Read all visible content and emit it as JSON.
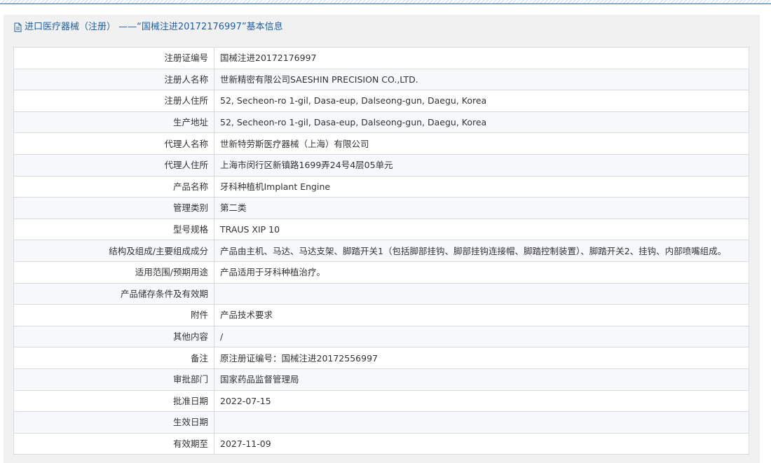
{
  "header": {
    "icon": "document-icon",
    "title": "进口医疗器械（注册） ——“国械注进20172176997”基本信息",
    "title_color": "#1f5fa8"
  },
  "rows": [
    {
      "label": "注册证编号",
      "value": "国械注进20172176997"
    },
    {
      "label": "注册人名称",
      "value": "世新精密有限公司SAESHIN PRECISION CO.,LTD."
    },
    {
      "label": "注册人住所",
      "value": "52, Secheon-ro 1-gil, Dasa-eup, Dalseong-gun, Daegu, Korea"
    },
    {
      "label": "生产地址",
      "value": "52, Secheon-ro 1-gil, Dasa-eup, Dalseong-gun, Daegu, Korea"
    },
    {
      "label": "代理人名称",
      "value": "世新特劳斯医疗器械（上海）有限公司"
    },
    {
      "label": "代理人住所",
      "value": "上海市闵行区新镇路1699弄24号4层05单元"
    },
    {
      "label": "产品名称",
      "value": "牙科种植机Implant Engine"
    },
    {
      "label": "管理类别",
      "value": "第二类"
    },
    {
      "label": "型号规格",
      "value": "TRAUS XIP 10"
    },
    {
      "label": "结构及组成/主要组成成分",
      "value": "产品由主机、马达、马达支架、脚踏开关1（包括脚部挂钩、脚部挂钩连接帽、脚踏控制装置）、脚踏开关2、挂钩、内部喷嘴组成。"
    },
    {
      "label": "适用范围/预期用途",
      "value": "产品适用于牙科种植治疗。"
    },
    {
      "label": "产品储存条件及有效期",
      "value": ""
    },
    {
      "label": "附件",
      "value": "产品技术要求"
    },
    {
      "label": "其他内容",
      "value": "/"
    },
    {
      "label": "备注",
      "value": "原注册证编号：国械注进20172556997"
    },
    {
      "label": "审批部门",
      "value": "国家药品监督管理局"
    },
    {
      "label": "批准日期",
      "value": "2022-07-15"
    },
    {
      "label": "生效日期",
      "value": ""
    },
    {
      "label": "有效期至",
      "value": "2027-11-09"
    }
  ]
}
